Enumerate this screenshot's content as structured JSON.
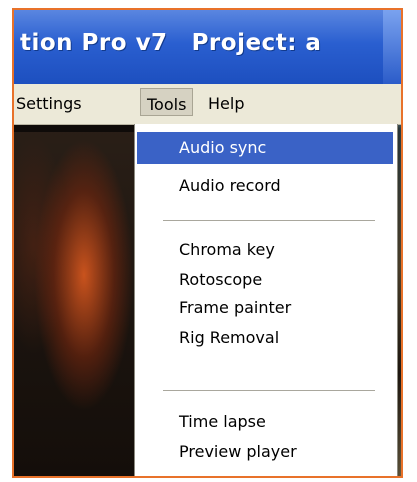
{
  "window": {
    "title_part1": "tion Pro v7",
    "title_part2": "Project: a"
  },
  "menubar": {
    "items": [
      {
        "label": "Settings"
      },
      {
        "label": "Tools"
      },
      {
        "label": "Help"
      }
    ]
  },
  "tools_menu": {
    "groups": [
      {
        "items": [
          {
            "label": "Audio sync",
            "highlighted": true
          },
          {
            "label": "Audio record"
          }
        ]
      },
      {
        "items": [
          {
            "label": "Chroma key"
          },
          {
            "label": "Rotoscope"
          },
          {
            "label": "Frame painter"
          },
          {
            "label": "Rig Removal"
          }
        ]
      },
      {
        "items": [
          {
            "label": "Time lapse"
          },
          {
            "label": "Preview player"
          }
        ]
      }
    ]
  },
  "colors": {
    "highlight": "#3a62c6",
    "titlebar": "#2a5fd0",
    "menubar": "#ece9d8",
    "frame_border": "#e8722a"
  }
}
